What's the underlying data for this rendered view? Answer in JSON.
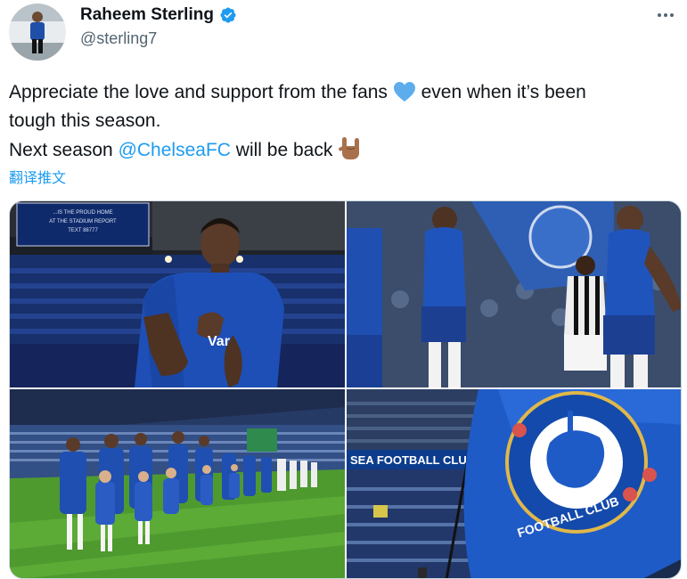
{
  "author": {
    "display_name": "Raheem Sterling",
    "handle": "@sterling7",
    "verified": true
  },
  "tweet": {
    "line1_before": "Appreciate the love and support from the fans ",
    "line1_after": " even when it’s been",
    "line2": "tough this season.",
    "line3_before": "Next season ",
    "mention": "@ChelseaFC",
    "line3_after": " will be back ",
    "emoji_heart": "blue-heart-icon",
    "emoji_hand": "sign-of-horns-icon"
  },
  "translate_label": "翻译推文",
  "media": {
    "photo1": {
      "sign_text_1": "...IS THE PROUD HOME",
      "sign_text_2": "AT THE STADIUM REPORT",
      "sign_text_3": "TEXT 88777",
      "shirt_text": "Var"
    },
    "photo2": {
      "description_icon": "players-walking-photo"
    },
    "photo3": {
      "description_icon": "lineup-photo"
    },
    "photo4": {
      "banner_text": "SEA FOOTBALL CLUB",
      "flag_text": "FOOTBALL CLUB"
    }
  },
  "colors": {
    "chelsea_blue": "#034694",
    "link_blue": "#1d9bf0",
    "verified_blue": "#1d9bf0",
    "secondary_text": "#536471"
  }
}
